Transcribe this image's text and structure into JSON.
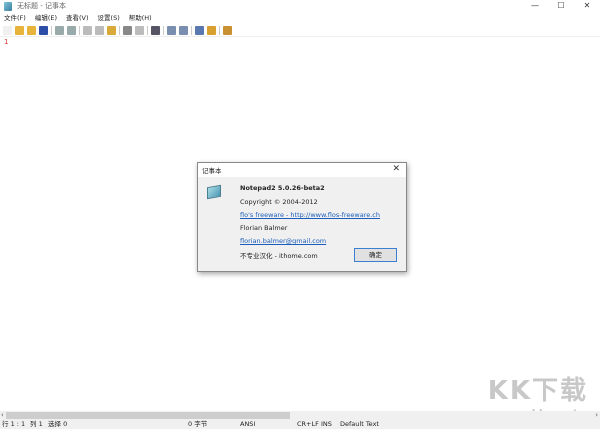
{
  "window": {
    "title": "无标题 - 记事本",
    "minimize": "—",
    "maximize": "☐",
    "close": "✕"
  },
  "menu": [
    "文件(F)",
    "编辑(E)",
    "查看(V)",
    "设置(S)",
    "帮助(H)"
  ],
  "toolbar_colors": [
    "#f0f0f0",
    "#e8b33a",
    "#e8b33a",
    "#2d4ea8",
    "sep",
    "#9aa",
    "#9aa",
    "sep",
    "#bbb",
    "#bbb",
    "#d9a93a",
    "sep",
    "#888",
    "#bbb",
    "sep",
    "#556",
    "sep",
    "#7a8fb0",
    "#7a8fb0",
    "sep",
    "#5a78b0",
    "#d8a030",
    "sep",
    "#c89030"
  ],
  "editor": {
    "line_number": "1"
  },
  "scrollbar": {
    "left": "‹",
    "right": "›"
  },
  "status": {
    "position": "行 1 : 1",
    "column": "列 1",
    "selection": "选择 0",
    "bytes": "0 字节",
    "encoding": "ANSI",
    "eol": "CR+LF",
    "mode": "INS",
    "scheme": "Default Text"
  },
  "dialog": {
    "title": "记事本",
    "close": "✕",
    "name": "Notepad2 5.0.26-beta2",
    "copyright": "Copyright © 2004-2012",
    "website": "flo's freeware - http://www.flos-freeware.ch",
    "author": "Florian Balmer",
    "email": "florian.balmer@gmail.com",
    "translation": "不专业汉化 - ithome.com",
    "ok": "确定"
  },
  "watermark": {
    "logo": "KK下载",
    "url": "www.kkx.net"
  }
}
